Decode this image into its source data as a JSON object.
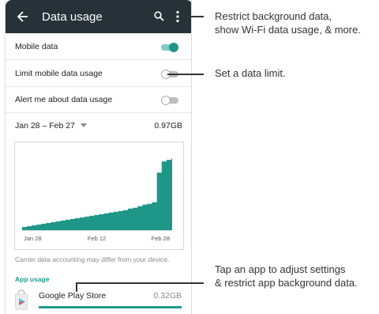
{
  "appbar": {
    "title": "Data usage"
  },
  "settings": {
    "mobile_data": {
      "label": "Mobile data",
      "on": true
    },
    "limit_usage": {
      "label": "Limit mobile data usage",
      "on": false
    },
    "alert_usage": {
      "label": "Alert me about data usage",
      "on": false
    }
  },
  "cycle": {
    "range": "Jan 28 – Feb 27",
    "total": "0.97GB"
  },
  "chart_data": {
    "type": "area",
    "x_ticks": [
      "Jan 28",
      "Feb 12",
      "Feb 28"
    ],
    "x": [
      0,
      1,
      2,
      3,
      4,
      5,
      6,
      7,
      8,
      9,
      10,
      11,
      12,
      13,
      14,
      15,
      16,
      17,
      18,
      19,
      20,
      21,
      22,
      23,
      24,
      25,
      26,
      27,
      28,
      29,
      30,
      31
    ],
    "values": [
      0.04,
      0.05,
      0.06,
      0.07,
      0.08,
      0.09,
      0.1,
      0.11,
      0.12,
      0.13,
      0.14,
      0.15,
      0.16,
      0.17,
      0.18,
      0.19,
      0.2,
      0.21,
      0.22,
      0.23,
      0.24,
      0.25,
      0.27,
      0.28,
      0.3,
      0.32,
      0.33,
      0.35,
      0.72,
      0.86,
      0.88,
      0.9
    ],
    "ylim": [
      0,
      1.0
    ],
    "color": "#1e9688"
  },
  "note": "Carrier data accounting may differ from your device.",
  "section": {
    "app_usage": "App usage"
  },
  "apps": [
    {
      "name": "Google Play Store",
      "size": "0.32GB",
      "share": 1.0
    }
  ],
  "callouts": {
    "menu": [
      "Restrict background data,",
      "show Wi-Fi data usage, & more."
    ],
    "limit": "Set a data limit.",
    "app": [
      "Tap an app to  adjust settings",
      "& restrict app background data."
    ]
  },
  "colors": {
    "appbar": "#263238",
    "accent": "#1e9688",
    "toggle_on": "#26a69a"
  }
}
